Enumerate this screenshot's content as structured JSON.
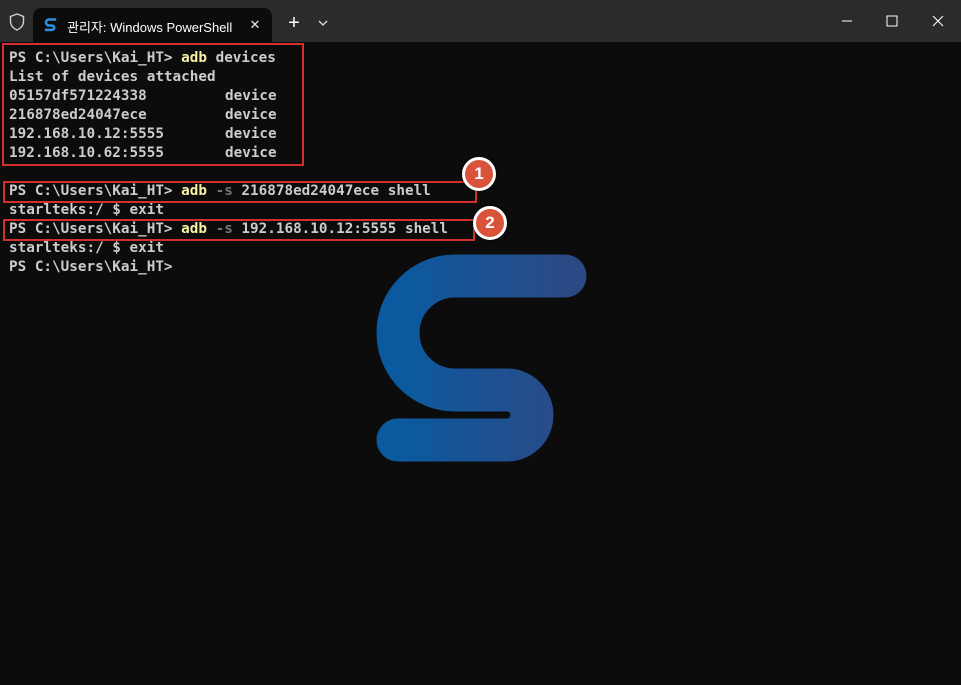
{
  "window": {
    "tab_title": "관리자: Windows PowerShell",
    "tab_close_glyph": "✕",
    "new_tab_glyph": "+"
  },
  "terminal": {
    "lines": [
      {
        "prompt": "PS C:\\Users\\Kai_HT> ",
        "cmd": "adb",
        "rest": " devices",
        "flag": ""
      },
      {
        "text": "List of devices attached"
      },
      {
        "serial": "05157df571224338",
        "state": "device"
      },
      {
        "serial": "216878ed24047ece",
        "state": "device"
      },
      {
        "serial": "192.168.10.12:5555",
        "state": "device"
      },
      {
        "serial": "192.168.10.62:5555",
        "state": "device"
      },
      {
        "text": ""
      },
      {
        "prompt": "PS C:\\Users\\Kai_HT> ",
        "cmd": "adb",
        "flag": " -s",
        "rest": " 216878ed24047ece shell"
      },
      {
        "text": "starlteks:/ $ exit"
      },
      {
        "prompt": "PS C:\\Users\\Kai_HT> ",
        "cmd": "adb",
        "flag": " -s",
        "rest": " 192.168.10.12:5555 shell"
      },
      {
        "text": "starlteks:/ $ exit"
      },
      {
        "prompt": "PS C:\\Users\\Kai_HT>",
        "cmd": "",
        "flag": "",
        "rest": ""
      }
    ]
  },
  "annotations": {
    "badge_1": "1",
    "badge_2": "2",
    "highlight_color": "#d32f2f",
    "badge_color": "#d9533b"
  },
  "colors": {
    "terminal_bg": "#0c0c0c",
    "titlebar_bg": "#2b2b2b",
    "text": "#cccccc",
    "command": "#f9f1a5",
    "flag": "#767676",
    "logo_gradient_start": "#0b5aa0",
    "logo_gradient_end": "#2a4a86"
  },
  "icons": {
    "window_shield": "shield-icon",
    "tab": "powershell-logo-icon",
    "dropdown": "chevron-down-icon",
    "minimize": "minimize-icon",
    "maximize": "maximize-icon",
    "close": "close-icon",
    "watermark": "s-logo-watermark"
  }
}
